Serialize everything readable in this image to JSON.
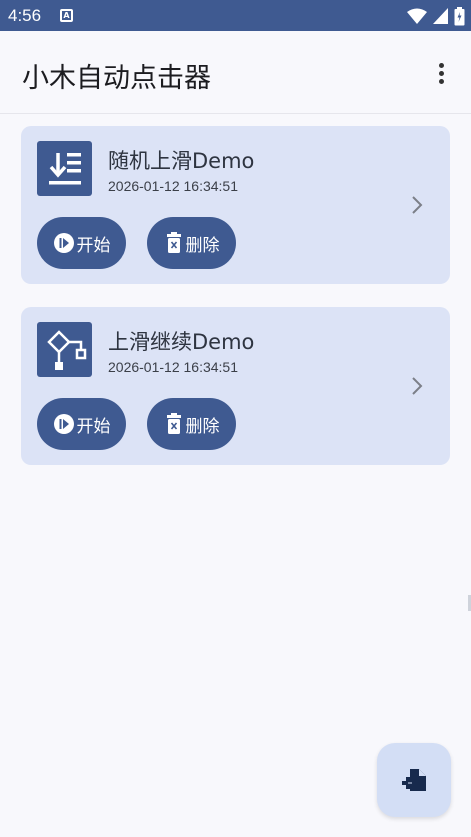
{
  "status_bar": {
    "time": "4:56",
    "notification_badge": "A"
  },
  "app_bar": {
    "title": "小木自动点击器",
    "menu_icon": "more-vert-icon"
  },
  "scripts": [
    {
      "title": "随机上滑Demo",
      "date": "2026-01-12 16:34:51",
      "icon": "swipe-list-icon",
      "start_label": "开始",
      "delete_label": "删除"
    },
    {
      "title": "上滑继续Demo",
      "date": "2026-01-12 16:34:51",
      "icon": "flowchart-icon",
      "start_label": "开始",
      "delete_label": "删除"
    }
  ],
  "fab": {
    "icon": "add-file-icon"
  },
  "colors": {
    "primary": "#3f5a91",
    "card_bg": "#dce3f6",
    "background": "#f8f8fc",
    "fab_bg": "#d3def5"
  }
}
